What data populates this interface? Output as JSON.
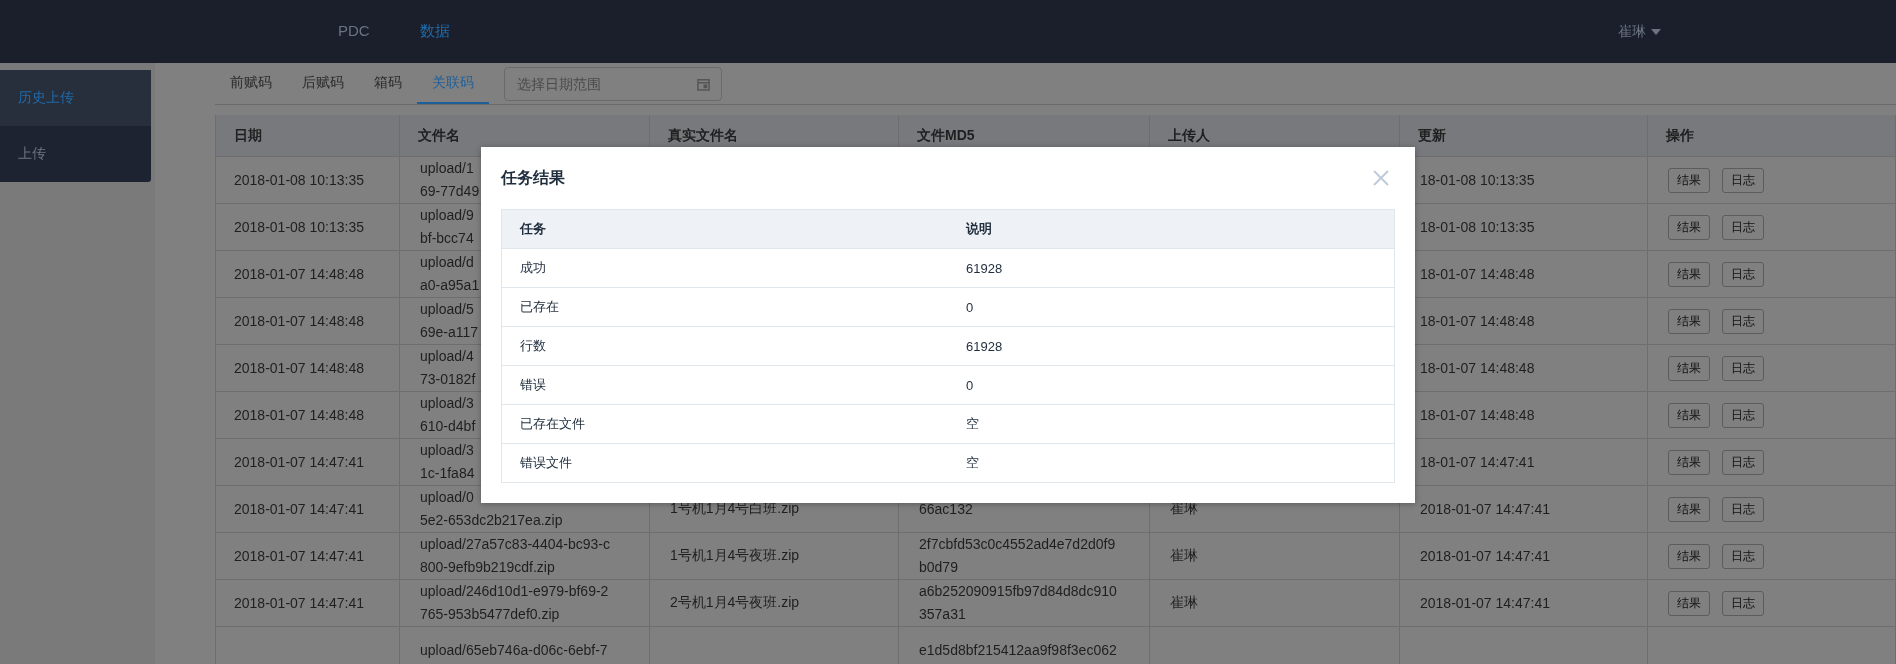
{
  "topbar": {
    "nav": [
      {
        "label": "PDC",
        "selected": false
      },
      {
        "label": "数据",
        "selected": true
      }
    ],
    "user": "崔琳"
  },
  "sidebar": {
    "items": [
      {
        "label": "历史上传",
        "selected": true
      },
      {
        "label": "上传",
        "selected": false
      }
    ]
  },
  "tabs": [
    {
      "label": "前赋码",
      "selected": false
    },
    {
      "label": "后赋码",
      "selected": false
    },
    {
      "label": "箱码",
      "selected": false
    },
    {
      "label": "关联码",
      "selected": true
    }
  ],
  "date_range": {
    "placeholder": "选择日期范围"
  },
  "table": {
    "columns": [
      "日期",
      "文件名",
      "真实文件名",
      "文件MD5",
      "上传人",
      "更新",
      "操作"
    ],
    "rows": [
      {
        "date": "2018-01-08 10:13:35",
        "file": [
          "upload/1",
          "69-77d49"
        ],
        "updated": "18-01-08 10:13:35",
        "actions": [
          "结果",
          "日志"
        ]
      },
      {
        "date": "2018-01-08 10:13:35",
        "file": [
          "upload/9",
          "bf-bcc74"
        ],
        "updated": "18-01-08 10:13:35",
        "actions": [
          "结果",
          "日志"
        ]
      },
      {
        "date": "2018-01-07 14:48:48",
        "file": [
          "upload/d",
          "a0-a95a1"
        ],
        "updated": "18-01-07 14:48:48",
        "actions": [
          "结果",
          "日志"
        ]
      },
      {
        "date": "2018-01-07 14:48:48",
        "file": [
          "upload/5",
          "69e-a117"
        ],
        "updated": "18-01-07 14:48:48",
        "actions": [
          "结果",
          "日志"
        ]
      },
      {
        "date": "2018-01-07 14:48:48",
        "file": [
          "upload/4",
          "73-0182f"
        ],
        "updated": "18-01-07 14:48:48",
        "actions": [
          "结果",
          "日志"
        ]
      },
      {
        "date": "2018-01-07 14:48:48",
        "file": [
          "upload/3",
          "610-d4bf"
        ],
        "updated": "18-01-07 14:48:48",
        "actions": [
          "结果",
          "日志"
        ]
      },
      {
        "date": "2018-01-07 14:47:41",
        "file": [
          "upload/3",
          "1c-1fa84"
        ],
        "updated": "18-01-07 14:47:41",
        "actions": [
          "结果",
          "日志"
        ]
      },
      {
        "date": "2018-01-07 14:47:41",
        "file": [
          "upload/0",
          "5e2-653dc2b217ea.zip"
        ],
        "real_name": "1号机1月4号白班.zip",
        "md5": [
          "66ac132"
        ],
        "uploader": "崔琳",
        "updated": "2018-01-07 14:47:41",
        "actions": [
          "结果",
          "日志"
        ]
      },
      {
        "date": "2018-01-07 14:47:41",
        "file": [
          "upload/27a57c83-4404-bc93-c",
          "800-9efb9b219cdf.zip"
        ],
        "real_name": "1号机1月4号夜班.zip",
        "md5": [
          "2f7cbfd53c0c4552ad4e7d2d0f9",
          "b0d79"
        ],
        "uploader": "崔琳",
        "updated": "2018-01-07 14:47:41",
        "actions": [
          "结果",
          "日志"
        ]
      },
      {
        "date": "2018-01-07 14:47:41",
        "file": [
          "upload/246d10d1-e979-bf69-2",
          "765-953b5477def0.zip"
        ],
        "real_name": "2号机1月4号夜班.zip",
        "md5": [
          "a6b252090915fb97d84d8dc910",
          "357a31"
        ],
        "uploader": "崔琳",
        "updated": "2018-01-07 14:47:41",
        "actions": [
          "结果",
          "日志"
        ]
      },
      {
        "file": [
          "upload/65eb746a-d06c-6ebf-7"
        ],
        "md5": [
          "e1d5d8bf215412aa9f98f3ec062"
        ]
      }
    ]
  },
  "dialog": {
    "title": "任务结果",
    "table": {
      "columns": [
        "任务",
        "说明"
      ],
      "rows": [
        [
          "成功",
          "61928"
        ],
        [
          "已存在",
          "0"
        ],
        [
          "行数",
          "61928"
        ],
        [
          "错误",
          "0"
        ],
        [
          "已存在文件",
          "空"
        ],
        [
          "错误文件",
          "空"
        ]
      ]
    }
  }
}
